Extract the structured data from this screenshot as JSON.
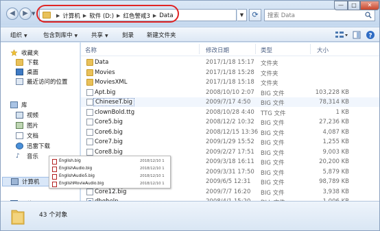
{
  "address": {
    "crumbs": [
      "计算机",
      "软件 (D:)",
      "红色警戒3",
      "Data"
    ],
    "search_placeholder": "搜索 Data"
  },
  "window_controls": {
    "minimize": "—",
    "maximize": "□",
    "close": "✕"
  },
  "toolbar": {
    "organize": "组织",
    "include_library": "包含到库中",
    "share": "共享",
    "burn": "刻录",
    "new_folder": "新建文件夹"
  },
  "nav": {
    "favorites": "收藏夹",
    "downloads": "下载",
    "desktop": "桌面",
    "recent": "最近访问的位置",
    "libraries": "库",
    "videos": "视频",
    "pictures": "图片",
    "documents": "文档",
    "thunder": "迅雷下载",
    "music": "音乐",
    "computer": "计算机",
    "network": "网络"
  },
  "columns": {
    "name": "名称",
    "date": "修改日期",
    "type": "类型",
    "size": "大小"
  },
  "files": [
    {
      "name": "Data",
      "date": "2017/1/18 15:17",
      "type": "文件夹",
      "size": "",
      "icon": "folder-icon"
    },
    {
      "name": "Movies",
      "date": "2017/1/18 15:28",
      "type": "文件夹",
      "size": "",
      "icon": "folder-icon"
    },
    {
      "name": "MoviesXML",
      "date": "2017/1/18 15:18",
      "type": "文件夹",
      "size": "",
      "icon": "folder-icon"
    },
    {
      "name": "Apt.big",
      "date": "2008/10/10 2:07",
      "type": "BIG 文件",
      "size": "103,228 KB",
      "icon": "file-icon"
    },
    {
      "name": "ChineseT.big",
      "date": "2009/7/17 4:50",
      "type": "BIG 文件",
      "size": "78,314 KB",
      "icon": "file-icon"
    },
    {
      "name": "clownBold.ttg",
      "date": "2008/10/28 4:40",
      "type": "TTG 文件",
      "size": "1 KB",
      "icon": "file-icon"
    },
    {
      "name": "Core5.big",
      "date": "2008/12/2 10:32",
      "type": "BIG 文件",
      "size": "27,236 KB",
      "icon": "file-icon"
    },
    {
      "name": "Core6.big",
      "date": "2008/12/15 13:36",
      "type": "BIG 文件",
      "size": "4,087 KB",
      "icon": "file-icon"
    },
    {
      "name": "Core7.big",
      "date": "2009/1/29 15:52",
      "type": "BIG 文件",
      "size": "1,255 KB",
      "icon": "file-icon"
    },
    {
      "name": "Core8.big",
      "date": "2009/2/27 17:51",
      "type": "BIG 文件",
      "size": "9,003 KB",
      "icon": "file-icon"
    },
    {
      "name": "",
      "date": "2009/3/18 16:11",
      "type": "BIG 文件",
      "size": "20,200 KB",
      "icon": "file-icon"
    },
    {
      "name": "",
      "date": "2009/3/31 17:50",
      "type": "BIG 文件",
      "size": "5,879 KB",
      "icon": "file-icon"
    },
    {
      "name": "",
      "date": "2009/6/5 12:31",
      "type": "BIG 文件",
      "size": "98,789 KB",
      "icon": "file-icon"
    },
    {
      "name": "Core12.big",
      "date": "2009/7/7 16:20",
      "type": "BIG 文件",
      "size": "3,938 KB",
      "icon": "file-icon"
    },
    {
      "name": "dbghelp",
      "date": "2008/4/1 15:20",
      "type": "DLL 文件",
      "size": "1,006 KB",
      "icon": "dll-icon"
    }
  ],
  "overlay_files": [
    {
      "name": "English.big",
      "date": "2018/12/10 1"
    },
    {
      "name": "EnglishAudio.big",
      "date": "2018/12/10 1"
    },
    {
      "name": "EnglishAudio5.big",
      "date": "2018/12/10 1"
    },
    {
      "name": "EnglishMovieAudio.big",
      "date": "2018/12/10 1"
    }
  ],
  "details": {
    "count": "43 个对象"
  },
  "colors": {
    "annotation": "#e02424",
    "folder": "#e9c15a",
    "selection": "#d9e7f8"
  }
}
